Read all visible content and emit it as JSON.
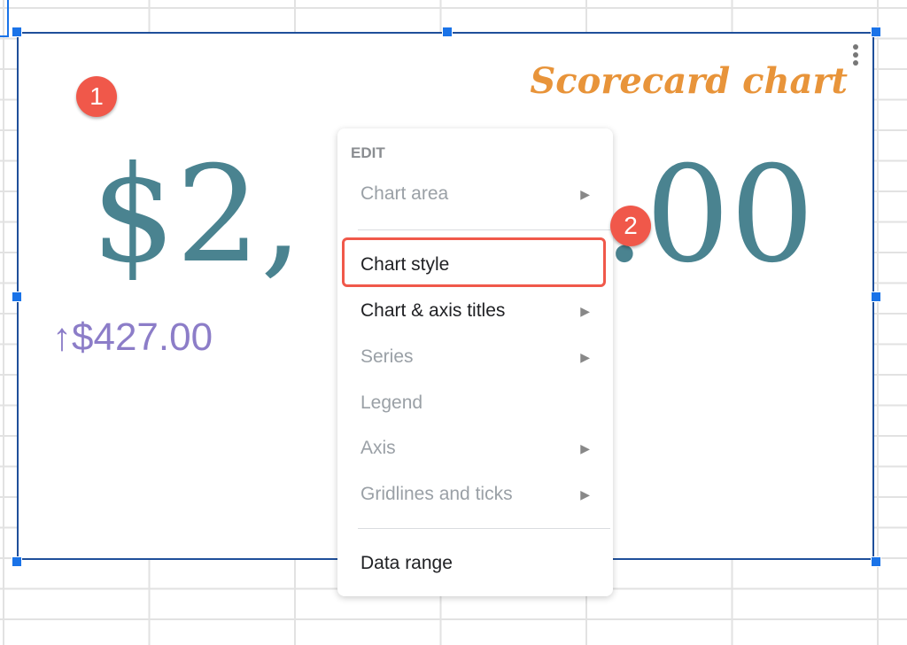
{
  "chart": {
    "title": "Scorecard chart",
    "value_visible_left": "$2,",
    "value_visible_right": ".00",
    "delta_arrow": "↑",
    "delta": "$427.00",
    "colors": {
      "value": "#4a8390",
      "delta": "#8c7dc8",
      "title": "#e8943a"
    }
  },
  "callouts": [
    "1",
    "2"
  ],
  "menu": {
    "header": "EDIT",
    "items": [
      {
        "label": "Chart area",
        "enabled": false,
        "submenu": true
      },
      {
        "label": "Chart style",
        "enabled": true,
        "submenu": false
      },
      {
        "label": "Chart & axis titles",
        "enabled": true,
        "submenu": true
      },
      {
        "label": "Series",
        "enabled": false,
        "submenu": true
      },
      {
        "label": "Legend",
        "enabled": false,
        "submenu": false
      },
      {
        "label": "Axis",
        "enabled": false,
        "submenu": true
      },
      {
        "label": "Gridlines and ticks",
        "enabled": false,
        "submenu": true
      },
      {
        "label": "Data range",
        "enabled": true,
        "submenu": false
      }
    ],
    "submenu_arrow": "▶"
  }
}
